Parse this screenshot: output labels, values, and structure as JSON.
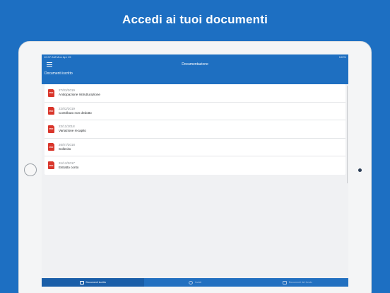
{
  "headline": "Accedi ai tuoi documenti",
  "statusbar": {
    "time": "10:37 AM",
    "date": "Mon Apr 15",
    "battery": "100%"
  },
  "navbar": {
    "title": "Documentazione"
  },
  "section": {
    "title": "Documenti iscritto"
  },
  "documents": [
    {
      "date": "27/03/2019",
      "title": "Anticipazione ristrutturazione"
    },
    {
      "date": "22/02/2019",
      "title": "Contributo non dedotto"
    },
    {
      "date": "23/11/2018",
      "title": "Variazione recapito"
    },
    {
      "date": "26/07/2018",
      "title": "Sollecito"
    },
    {
      "date": "31/12/2017",
      "title": "Estratto conto"
    }
  ],
  "pdf_label": "PDF",
  "tabs": [
    {
      "label": "Documenti iscritto",
      "active": true
    },
    {
      "label": "Inviati",
      "active": false
    },
    {
      "label": "Documenti del fondo",
      "active": false
    }
  ],
  "colors": {
    "brand": "#1e6fc1",
    "pdf": "#d9362b"
  }
}
